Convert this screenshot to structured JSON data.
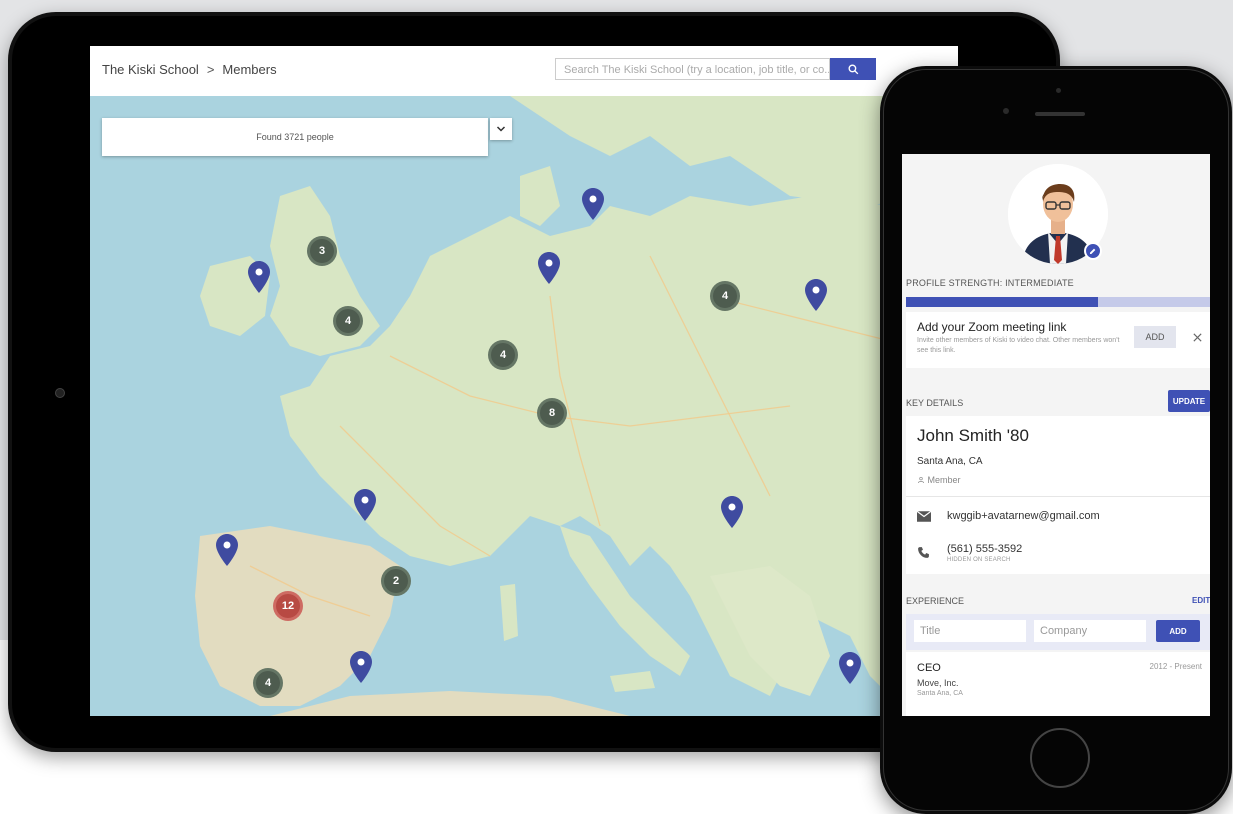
{
  "tablet": {
    "breadcrumb": {
      "school": "The Kiski School",
      "separator": ">",
      "page": "Members"
    },
    "search": {
      "placeholder": "Search The Kiski School (try a location, job title, or co..."
    },
    "found_text": "Found 3721 people",
    "clusters": [
      {
        "label": "3",
        "color": "dark"
      },
      {
        "label": "4",
        "color": "dark"
      },
      {
        "label": "4",
        "color": "dark"
      },
      {
        "label": "4",
        "color": "dark"
      },
      {
        "label": "8",
        "color": "dark"
      },
      {
        "label": "2",
        "color": "dark"
      },
      {
        "label": "12",
        "color": "red"
      },
      {
        "label": "4",
        "color": "dark"
      }
    ],
    "pin_color": "#3f4ba0"
  },
  "phone": {
    "profile_strength_label": "PROFILE STRENGTH: INTERMEDIATE",
    "profile_strength_fraction": 0.63,
    "zoom": {
      "title": "Add your Zoom meeting link",
      "description": "Invite other members of Kiski to video chat. Other members won't see this link.",
      "add_label": "ADD"
    },
    "key_details_label": "KEY DETAILS",
    "update_label": "UPDATE",
    "profile": {
      "name": "John Smith '80",
      "location": "Santa Ana, CA",
      "role": "Member",
      "email": "kwggib+avatarnew@gmail.com",
      "phone": "(561) 555-3592",
      "phone_note": "HIDDEN ON SEARCH"
    },
    "experience_label": "EXPERIENCE",
    "edit_label": "EDIT",
    "experience_form": {
      "title_placeholder": "Title",
      "company_placeholder": "Company",
      "add_label": "ADD"
    },
    "experience_item": {
      "title": "CEO",
      "dates": "2012 - Present",
      "company": "Move, Inc.",
      "location": "Santa Ana, CA"
    }
  },
  "colors": {
    "accent": "#3f51b5",
    "cluster_red": "#b84a43",
    "cluster_dark": "#4e5c4f",
    "sea": "#aad3df",
    "land": "#d8e6c4"
  }
}
